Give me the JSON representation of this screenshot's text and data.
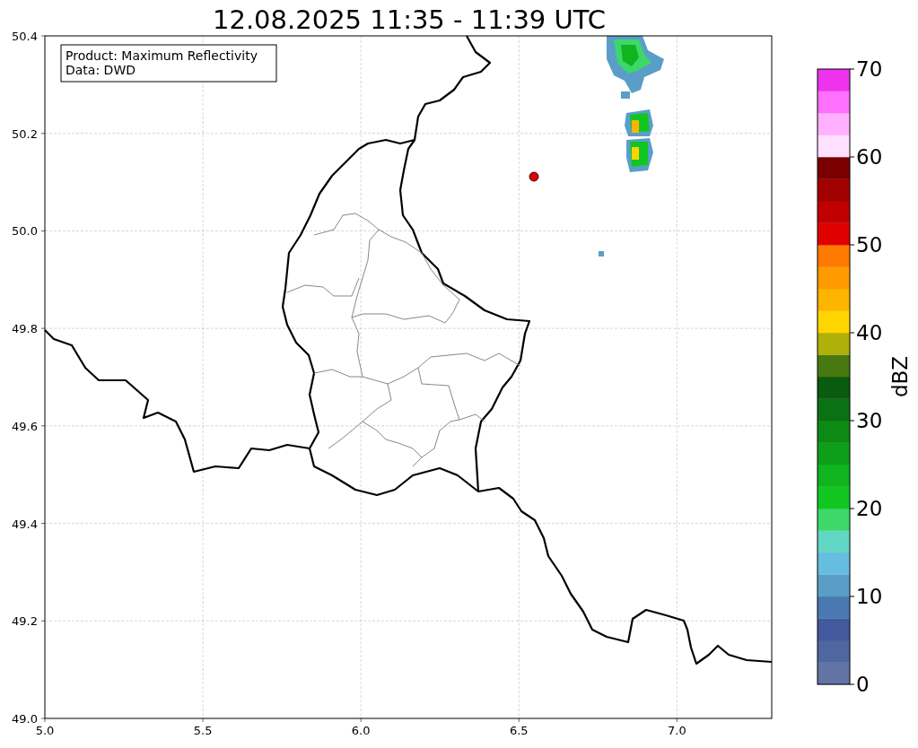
{
  "title": "12.08.2025 11:35 - 11:39 UTC",
  "info_box": {
    "lines": [
      "Product: Maximum Reflectivity",
      "Data: DWD"
    ]
  },
  "map": {
    "xticks": [
      "5.0",
      "5.5",
      "6.0",
      "6.5",
      "7.0"
    ],
    "yticks": [
      "50.4",
      "50.2",
      "50.0",
      "49.8",
      "49.6",
      "49.4",
      "49.2",
      "49.0"
    ]
  },
  "colorbar": {
    "label": "dBZ",
    "ticks": [
      "70",
      "60",
      "50",
      "40",
      "30",
      "20",
      "10",
      "0"
    ],
    "segments": [
      {
        "color": "#6273a6"
      },
      {
        "color": "#5066a0"
      },
      {
        "color": "#42599e"
      },
      {
        "color": "#4a78b0"
      },
      {
        "color": "#5a9ec8"
      },
      {
        "color": "#65bde0"
      },
      {
        "color": "#62d6c4"
      },
      {
        "color": "#3ed76a"
      },
      {
        "color": "#12c622"
      },
      {
        "color": "#10b41e"
      },
      {
        "color": "#0e9e1a"
      },
      {
        "color": "#0c8a14"
      },
      {
        "color": "#0a7212"
      },
      {
        "color": "#0a5a10"
      },
      {
        "color": "#487810"
      },
      {
        "color": "#b0b00a"
      },
      {
        "color": "#ffd500"
      },
      {
        "color": "#ffb400"
      },
      {
        "color": "#ff9a00"
      },
      {
        "color": "#ff7a00"
      },
      {
        "color": "#e00000"
      },
      {
        "color": "#c00000"
      },
      {
        "color": "#a00000"
      },
      {
        "color": "#7a0000"
      },
      {
        "color": "#ffe0ff"
      },
      {
        "color": "#ffb0ff"
      },
      {
        "color": "#ff70ff"
      },
      {
        "color": "#ee33ee"
      }
    ]
  }
}
